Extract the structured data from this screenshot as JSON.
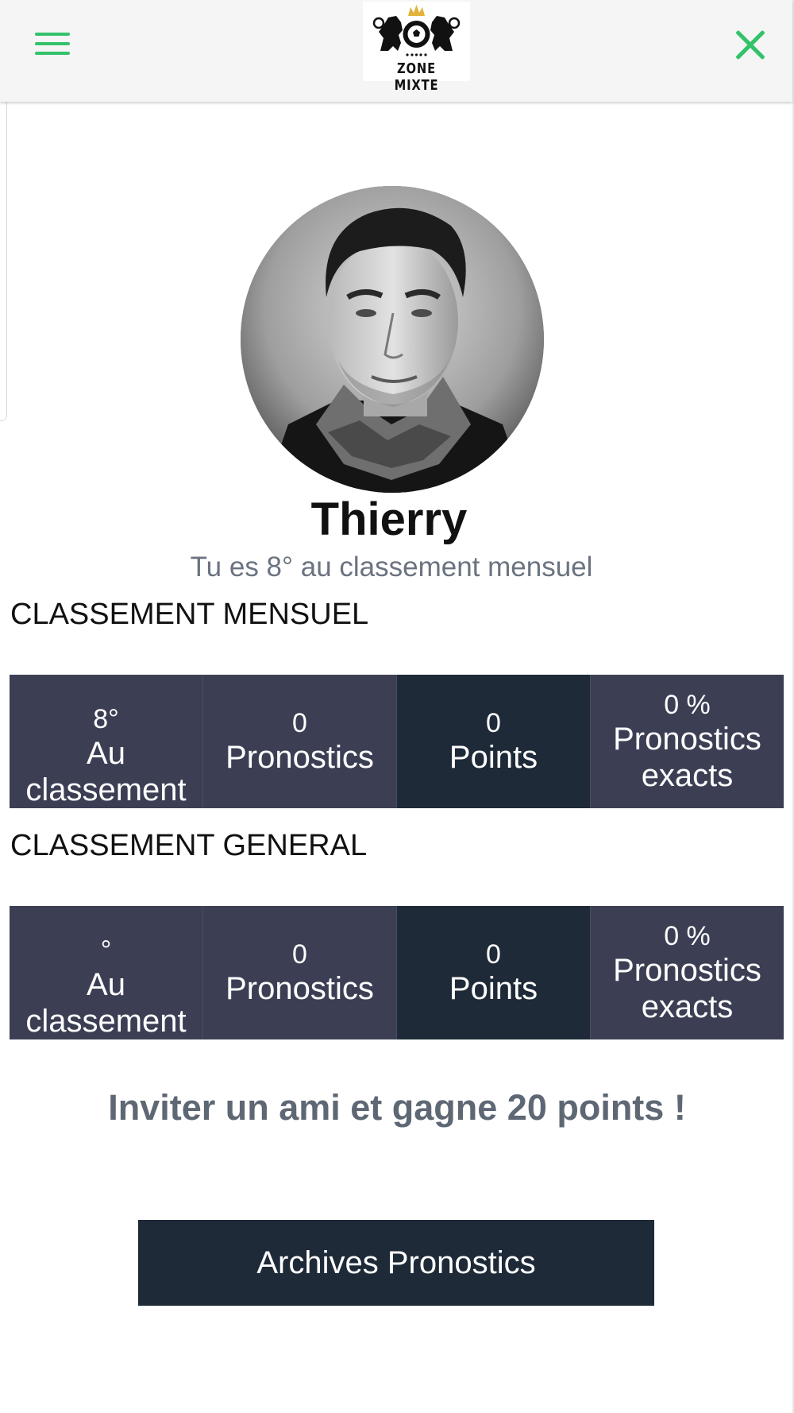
{
  "header": {
    "logo_text": "ZONE MIXTE"
  },
  "profile": {
    "name": "Thierry",
    "rank_text": "Tu es 8° au classement mensuel"
  },
  "monthly": {
    "title": "CLASSEMENT MENSUEL",
    "stats": [
      {
        "value": "8°",
        "label": "Au classement"
      },
      {
        "value": "0",
        "label": "Pronostics"
      },
      {
        "value": "0",
        "label": "Points"
      },
      {
        "value": "0 %",
        "label": "Pronostics exacts"
      }
    ]
  },
  "general": {
    "title": "CLASSEMENT GENERAL",
    "stats": [
      {
        "value": "°",
        "label": "Au classement"
      },
      {
        "value": "0",
        "label": "Pronostics"
      },
      {
        "value": "0",
        "label": "Points"
      },
      {
        "value": "0 %",
        "label": "Pronostics exacts"
      }
    ]
  },
  "invite_text": "Inviter un ami et gagne 20 points !",
  "archives_button": "Archives Pronostics",
  "colors": {
    "accent_green": "#33c26a",
    "stat_bg": "#3c3f54",
    "stat_dark_bg": "#1e2a38",
    "button_bg": "#1e2a38"
  },
  "icons": {
    "menu": "hamburger-menu-icon",
    "close": "close-x-icon"
  }
}
